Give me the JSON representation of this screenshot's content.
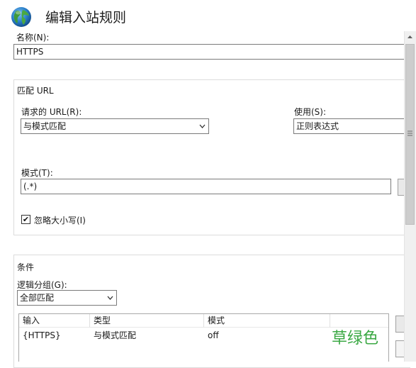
{
  "header": {
    "title": "编辑入站规则"
  },
  "name": {
    "label": "名称(N):",
    "value": "HTTPS"
  },
  "match_url": {
    "section_title": "匹配 URL",
    "requested_url": {
      "label": "请求的 URL(R):",
      "value": "与模式匹配"
    },
    "using": {
      "label": "使用(S):",
      "value": "正则表达式"
    },
    "pattern": {
      "label": "模式(T):",
      "value": "(.*)"
    },
    "ignore_case": {
      "label": "忽略大小写(I)",
      "checked": true,
      "mark": "✔"
    }
  },
  "conditions": {
    "section_title": "条件",
    "logical_grouping": {
      "label": "逻辑分组(G):",
      "value": "全部匹配"
    },
    "table": {
      "columns": [
        "输入",
        "类型",
        "模式"
      ],
      "rows": [
        {
          "input": "{HTTPS}",
          "type": "与模式匹配",
          "pattern": "off"
        }
      ]
    }
  },
  "watermark": "草绿色",
  "icons": {
    "title_icon": "globe-icon",
    "dropdown": "chevron-down-icon",
    "scroll_up": "scroll-up-arrow-icon"
  },
  "colors": {
    "watermark": "#3aa843",
    "border": "#7a7a7a",
    "scrollbar_thumb": "#cdcdcd"
  }
}
